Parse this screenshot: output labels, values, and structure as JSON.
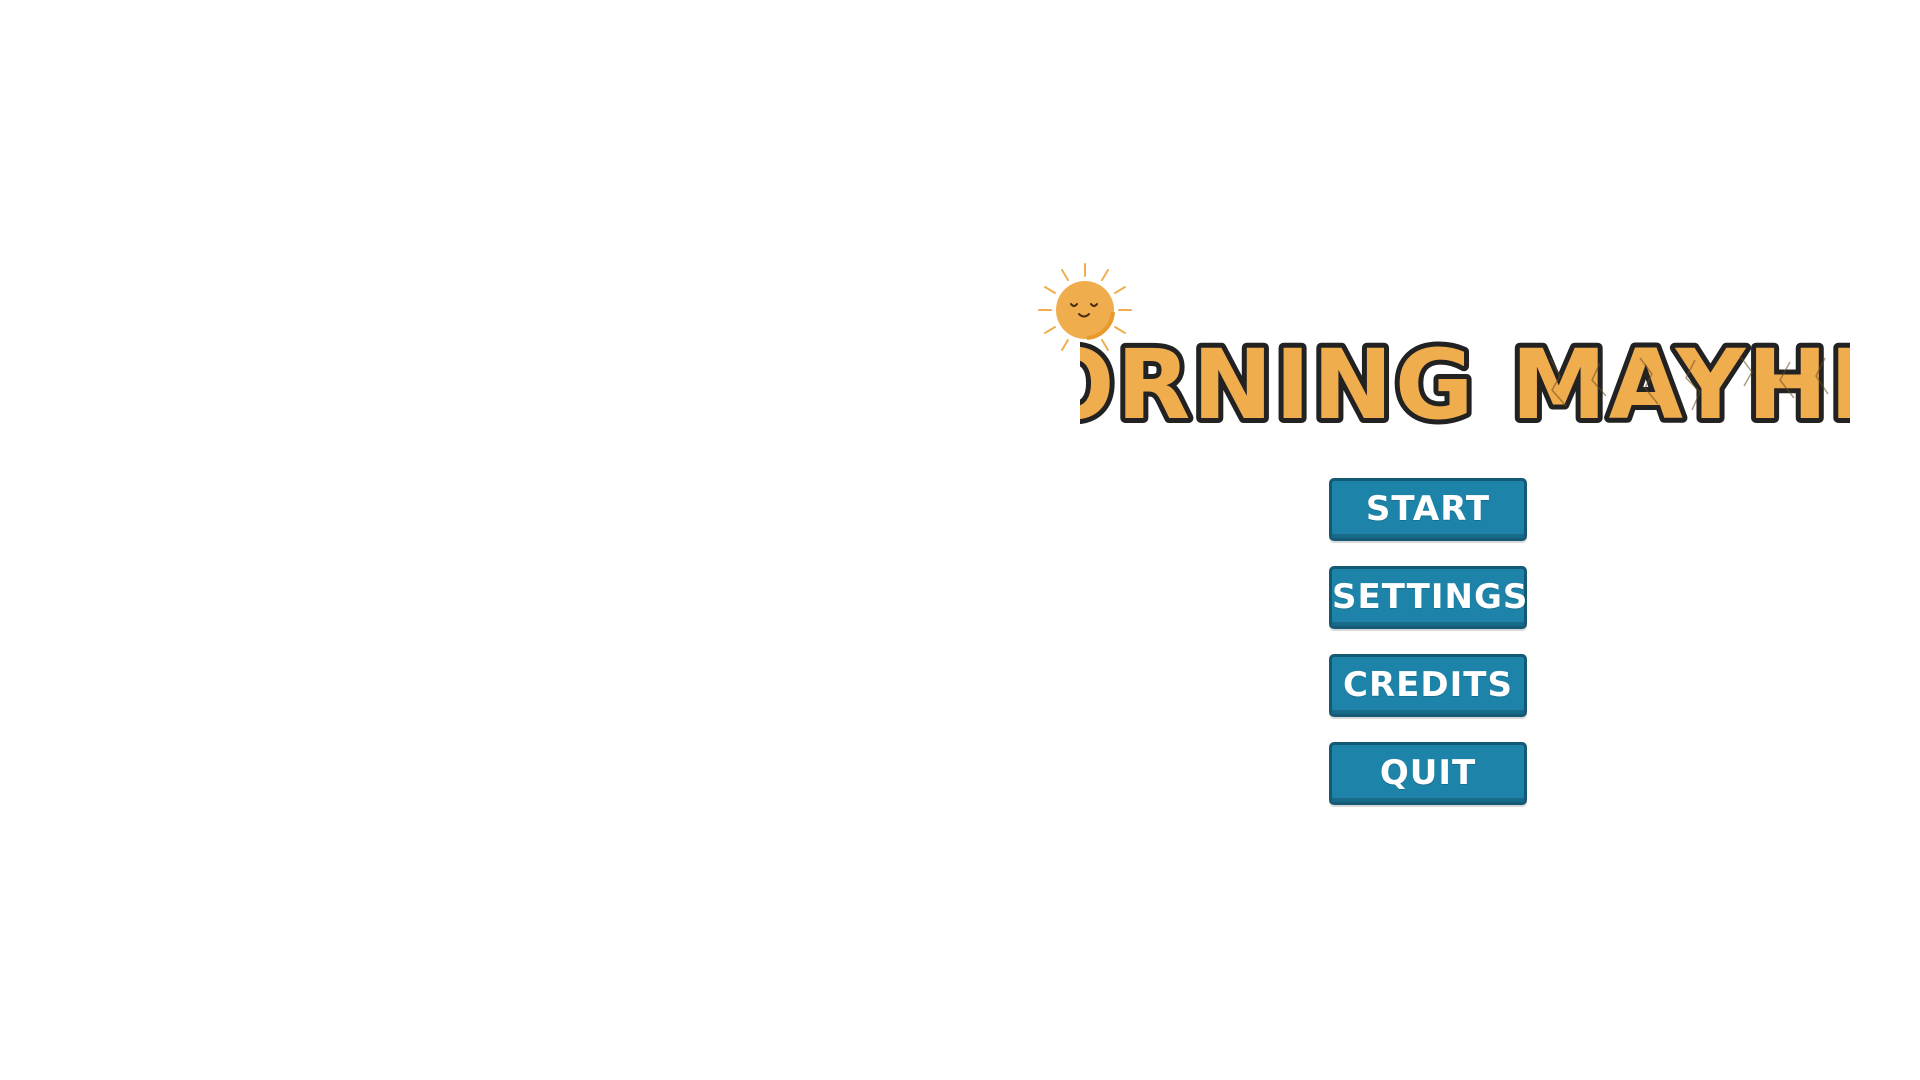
{
  "game": {
    "title": "MORNING MAYHEM",
    "colors": {
      "background": "#ffffff",
      "title_fill": "#f0ad4e",
      "title_outline": "#222222",
      "sun": "#f0ad4e",
      "button_fill": "#1d83a8",
      "button_border": "#145a74",
      "button_text": "#ffffff"
    },
    "logo_icon": "smiling-sun-icon"
  },
  "menu": {
    "items": [
      {
        "label": "START"
      },
      {
        "label": "SETTINGS"
      },
      {
        "label": "CREDITS"
      },
      {
        "label": "QUIT"
      }
    ]
  }
}
